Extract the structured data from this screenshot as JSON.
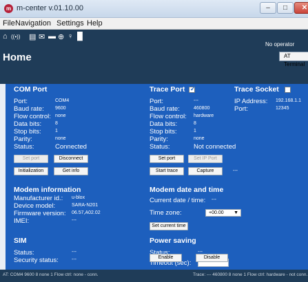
{
  "window": {
    "title": "m-center v.01.10.00",
    "controls": {
      "minimize": "–",
      "maximize": "□",
      "close": "✕"
    },
    "close_color": "#c9443a"
  },
  "menu": {
    "items": [
      "File",
      "Navigation",
      "Settings",
      "Help"
    ]
  },
  "toolbar": {
    "icons": [
      "home-icon",
      "signal-icon",
      "phonebook-icon",
      "mail-icon",
      "folder-icon",
      "network-icon",
      "gps-icon",
      "car-icon"
    ],
    "glyphs": [
      "⌂",
      "((•))",
      "▤",
      "✉",
      "▬",
      "⊕",
      "♀",
      "█"
    ]
  },
  "header": {
    "operator": "No operator",
    "page_title": "Home",
    "at_terminal_label": "AT Terminal"
  },
  "com_port": {
    "title": "COM Port",
    "labels": {
      "port": "Port:",
      "baud": "Baud rate:",
      "flow": "Flow control:",
      "data": "Data bits:",
      "stop": "Stop bits:",
      "parity": "Parity:",
      "status": "Status:"
    },
    "values": {
      "port": "COM4",
      "baud": "9600",
      "flow": "none",
      "data": "8",
      "stop": "1",
      "parity": "none",
      "status": "Connected"
    },
    "buttons": {
      "set_port": "Set port",
      "disconnect": "Disconnect",
      "initialization": "Initialization",
      "get_info": "Get info"
    }
  },
  "trace_port": {
    "title": "Trace Port",
    "enabled": true,
    "labels": {
      "port": "Port:",
      "baud": "Baud rate:",
      "flow": "Flow control:",
      "data": "Data bits:",
      "stop": "Stop bits:",
      "parity": "Parity:",
      "status": "Status:"
    },
    "values": {
      "port": "---",
      "baud": "460800",
      "flow": "hardware",
      "data": "8",
      "stop": "1",
      "parity": "none",
      "status": "Not connected"
    },
    "buttons": {
      "set_port": "Set port",
      "set_ip_port": "Set IP Port",
      "start_trace": "Start trace",
      "capture": "Capture"
    },
    "extra": "---"
  },
  "trace_socket": {
    "title": "Trace Socket",
    "enabled": false,
    "labels": {
      "ip": "IP Address:",
      "port": "Port:"
    },
    "values": {
      "ip": "192.168.1.1",
      "port": "12345"
    }
  },
  "modem_info": {
    "title": "Modem information",
    "labels": {
      "manufacturer": "Manufacturer id.:",
      "model": "Device model:",
      "firmware": "Firmware version:",
      "imei": "IMEI:"
    },
    "values": {
      "manufacturer": "u-blox",
      "model": "SARA-N201",
      "firmware": "06.57,A02.02",
      "imei": "---"
    }
  },
  "modem_time": {
    "title": "Modem date and time",
    "current_label": "Current date / time:",
    "current_value": "---",
    "timezone_label": "Time zone:",
    "timezone_value": "+00.00",
    "set_time_button": "Set current time"
  },
  "sim": {
    "title": "SIM",
    "labels": {
      "status": "Status:",
      "security": "Security status:"
    },
    "values": {
      "status": "---",
      "security": "---"
    }
  },
  "power_saving": {
    "title": "Power saving",
    "status_label": "Status:",
    "status_value": "---",
    "timeout_label": "Timeout (sec):",
    "timeout_value": "",
    "enable_button": "Enable",
    "disable_button": "Disable"
  },
  "statusbar": {
    "left": "AT: COM4 9600 8 none 1 Flow ctrl: none - conn.",
    "right": "Trace: --- 460800 8 none 1 Flow ctrl: hardware - not conn."
  },
  "colors": {
    "panel_blue": "#1d5fbd",
    "header_navy": "#1f3c58"
  }
}
